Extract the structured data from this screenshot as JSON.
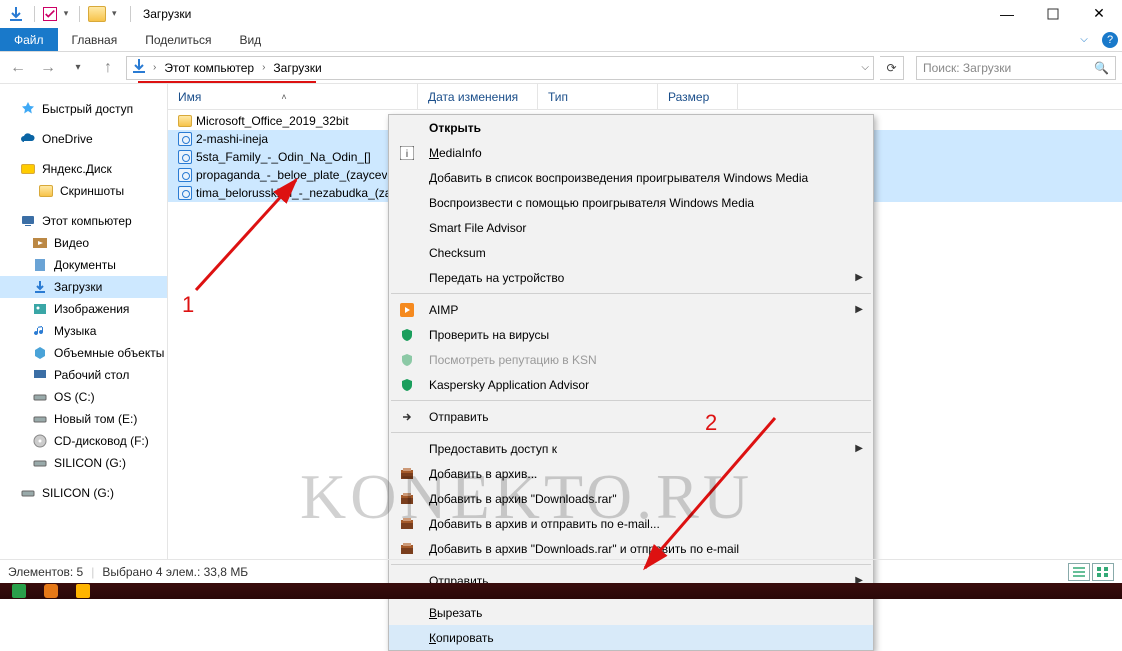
{
  "window": {
    "title": "Загрузки"
  },
  "ribbon": {
    "file": "Файл",
    "tabs": [
      "Главная",
      "Поделиться",
      "Вид"
    ]
  },
  "address": {
    "crumbs": [
      "Этот компьютер",
      "Загрузки"
    ]
  },
  "search": {
    "placeholder": "Поиск: Загрузки"
  },
  "sidebar": {
    "quick_access": "Быстрый доступ",
    "onedrive": "OneDrive",
    "yandex_disk": "Яндекс.Диск",
    "screenshots": "Скриншоты",
    "this_pc": "Этот компьютер",
    "items": [
      "Видео",
      "Документы",
      "Загрузки",
      "Изображения",
      "Музыка",
      "Объемные объекты",
      "Рабочий стол",
      "OS (C:)",
      "Новый том (E:)",
      "CD-дисковод (F:)",
      "SILICON (G:)"
    ],
    "silicon2": "SILICON (G:)"
  },
  "columns": {
    "name": "Имя",
    "date": "Дата изменения",
    "type": "Тип",
    "size": "Размер"
  },
  "files": [
    {
      "name": "Microsoft_Office_2019_32bit",
      "kind": "folder",
      "selected": false
    },
    {
      "name": "2-mashi-ineja",
      "kind": "audio",
      "selected": true
    },
    {
      "name": "5sta_Family_-_Odin_Na_Odin_[]",
      "kind": "audio",
      "selected": true
    },
    {
      "name": "propaganda_-_beloe_plate_(zaycev",
      "kind": "audio",
      "selected": true
    },
    {
      "name": "tima_belorusskikh_-_nezabudka_(zaycev",
      "kind": "audio",
      "selected": true
    }
  ],
  "context_menu": {
    "open": "Открыть",
    "mediainfo": "MediaInfo",
    "add_wmp_list": "Добавить в список воспроизведения проигрывателя Windows Media",
    "play_wmp": "Воспроизвести с помощью проигрывателя Windows Media",
    "smart_file_advisor": "Smart File Advisor",
    "checksum": "Checksum",
    "cast": "Передать на устройство",
    "aimp": "AIMP",
    "scan": "Проверить на вирусы",
    "ksn": "Посмотреть репутацию в KSN",
    "kav_advisor": "Kaspersky Application Advisor",
    "send": "Отправить",
    "share": "Предоставить доступ к",
    "add_archive": "Добавить в архив...",
    "add_downloads_rar": "Добавить в архив \"Downloads.rar\"",
    "add_email": "Добавить в архив и отправить по e-mail...",
    "add_downloads_rar_email": "Добавить в архив \"Downloads.rar\" и отправить по e-mail",
    "send_to": "Отправить",
    "cut": "Вырезать",
    "copy": "Копировать"
  },
  "status": {
    "elements": "Элементов: 5",
    "selected": "Выбрано 4 элем.: 33,8 МБ"
  },
  "annotations": {
    "n1": "1",
    "n2": "2"
  },
  "watermark": "KONEKTO.RU"
}
